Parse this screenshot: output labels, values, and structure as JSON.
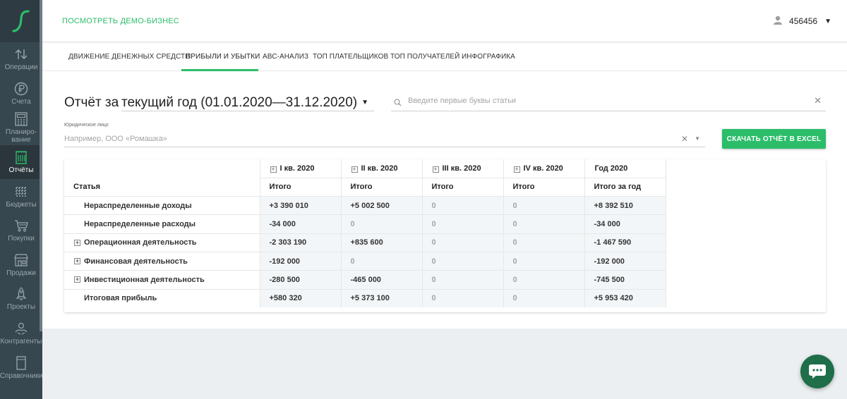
{
  "sidebar": {
    "items": [
      {
        "label": "Операции",
        "icon": "arrows-icon"
      },
      {
        "label": "Счета",
        "icon": "ruble-coin-icon"
      },
      {
        "label": "Планиро-вание",
        "icon": "calculator-icon"
      },
      {
        "label": "Отчёты",
        "icon": "report-icon",
        "active": true
      },
      {
        "label": "Бюджеты",
        "icon": "grid-icon"
      },
      {
        "label": "Покупки",
        "icon": "cart-icon"
      },
      {
        "label": "Продажи",
        "icon": "store-icon"
      },
      {
        "label": "Проекты",
        "icon": "rocket-icon"
      },
      {
        "label": "Контрагенты",
        "icon": "handshake-icon"
      },
      {
        "label": "Справочники",
        "icon": "book-icon"
      }
    ]
  },
  "header": {
    "demo_link": "ПОСМОТРЕТЬ ДЕМО-БИЗНЕС",
    "user_name": "456456"
  },
  "tabs": [
    {
      "label": "ДВИЖЕНИЕ ДЕНЕЖНЫХ СРЕДСТВ"
    },
    {
      "label": "ПРИБЫЛИ И УБЫТКИ",
      "active": true
    },
    {
      "label": "АВС-АНАЛИЗ"
    },
    {
      "label": "ТОП ПЛАТЕЛЬЩИКОВ"
    },
    {
      "label": "ТОП ПОЛУЧАТЕЛЕЙ"
    },
    {
      "label": "ИНФОГРАФИКА"
    }
  ],
  "report": {
    "title_prefix": "Отчёт за",
    "period": "текущий год (01.01.2020—31.12.2020)",
    "search_placeholder": "Введите первые буквы статьи",
    "legal_label": "Юридическое лицо",
    "legal_placeholder": "Например, ООО «Ромашка»",
    "excel_button": "СКАЧАТЬ ОТЧЁТ В EXCEL"
  },
  "table": {
    "col_statya": "Статья",
    "quarters": [
      "I кв. 2020",
      "II кв. 2020",
      "III кв. 2020",
      "IV кв. 2020"
    ],
    "year_header": "Год 2020",
    "sub_itogo": "Итого",
    "sub_year": "Итого за год",
    "rows": [
      {
        "name": "Нераспределенные доходы",
        "expandable": false,
        "values": [
          "+3 390 010",
          "+5 002 500",
          "0",
          "0",
          "+8 392 510"
        ]
      },
      {
        "name": "Нераспределенные расходы",
        "expandable": false,
        "values": [
          "-34 000",
          "0",
          "0",
          "0",
          "-34 000"
        ]
      },
      {
        "name": "Операционная деятельность",
        "expandable": true,
        "values": [
          "-2 303 190",
          "+835 600",
          "0",
          "0",
          "-1 467 590"
        ]
      },
      {
        "name": "Финансовая деятельность",
        "expandable": true,
        "values": [
          "-192 000",
          "0",
          "0",
          "0",
          "-192 000"
        ]
      },
      {
        "name": "Инвестиционная деятельность",
        "expandable": true,
        "values": [
          "-280 500",
          "-465 000",
          "0",
          "0",
          "-745 500"
        ]
      },
      {
        "name": "Итоговая прибыль",
        "expandable": false,
        "values": [
          "+580 320",
          "+5 373 100",
          "0",
          "0",
          "+5 953 420"
        ]
      }
    ]
  },
  "colors": {
    "accent": "#2bbd6a",
    "sidebar": "#37474f",
    "chat": "#1e6e4a"
  }
}
